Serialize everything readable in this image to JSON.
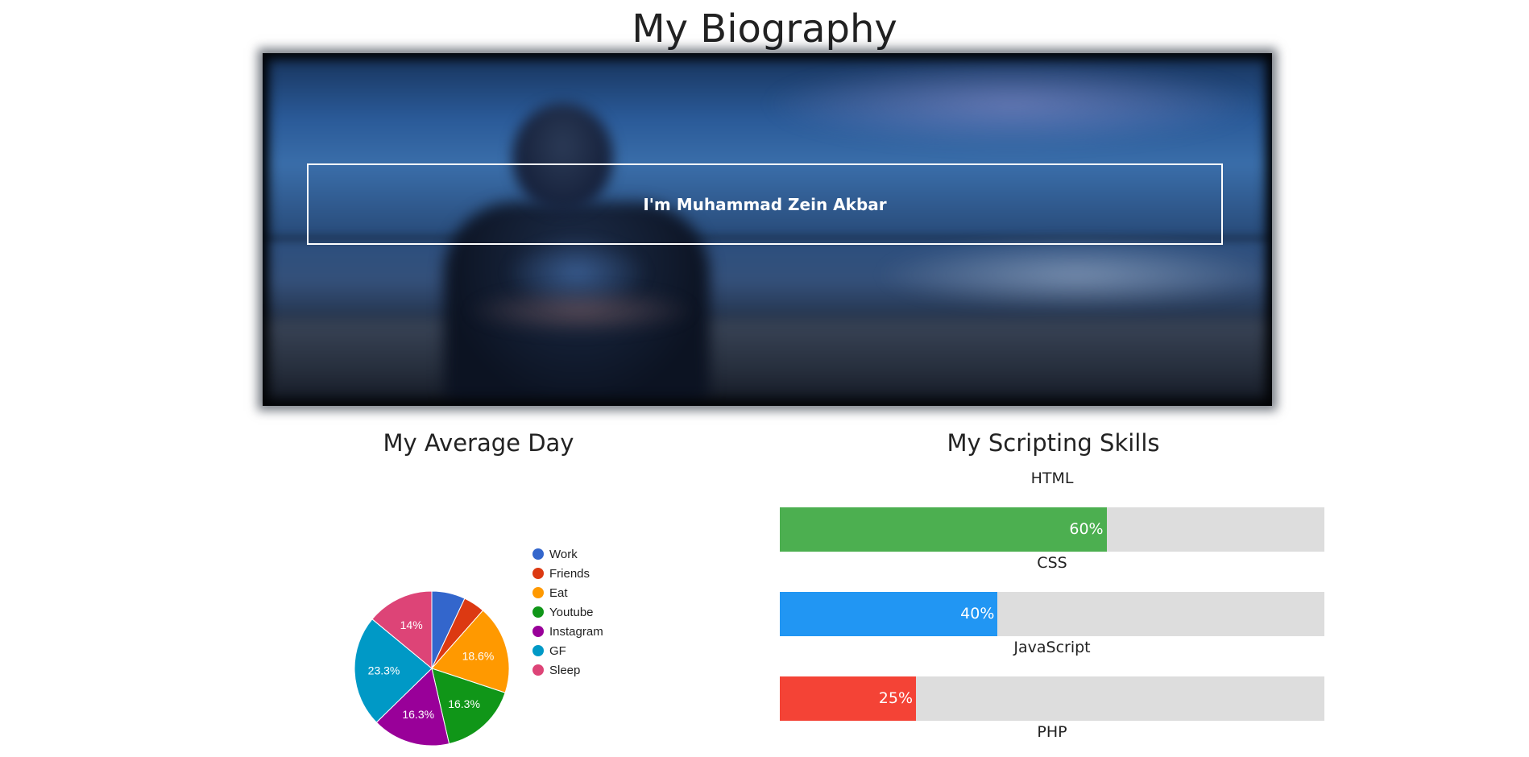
{
  "page": {
    "title": "My Biography"
  },
  "hero": {
    "caption": "I'm Muhammad Zein Akbar"
  },
  "average_day": {
    "title": "My Average Day"
  },
  "skills": {
    "title": "My Scripting Skills",
    "items": [
      {
        "label": "HTML",
        "percent": 60,
        "percent_label": "60%",
        "color": "#4caf50"
      },
      {
        "label": "CSS",
        "percent": 40,
        "percent_label": "40%",
        "color": "#2196f3"
      },
      {
        "label": "JavaScript",
        "percent": 25,
        "percent_label": "25%",
        "color": "#f44336"
      },
      {
        "label": "PHP"
      }
    ],
    "track_color": "#dddddd"
  },
  "chart_data": {
    "type": "pie",
    "title": "",
    "legend_position": "right",
    "categories": [
      "Work",
      "Friends",
      "Eat",
      "Youtube",
      "Instagram",
      "GF",
      "Sleep"
    ],
    "values": [
      7.0,
      4.5,
      18.6,
      16.3,
      16.3,
      23.3,
      14.0
    ],
    "slice_labels": [
      "",
      "",
      "18.6%",
      "16.3%",
      "16.3%",
      "23.3%",
      "14%"
    ],
    "colors": [
      "#3366cc",
      "#dc3912",
      "#ff9900",
      "#109618",
      "#990099",
      "#0099c6",
      "#dd4477"
    ]
  }
}
